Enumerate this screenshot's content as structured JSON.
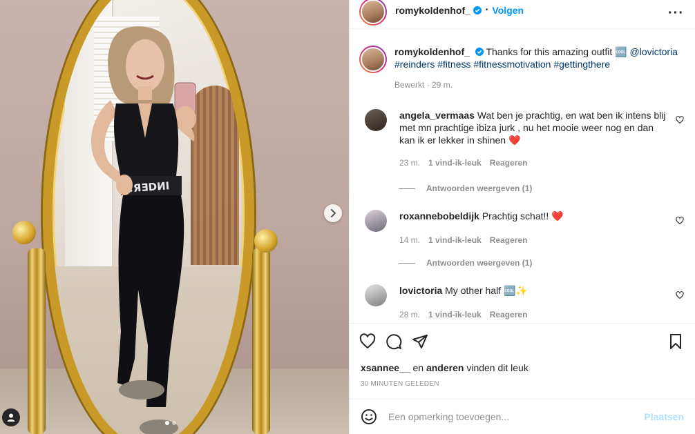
{
  "post": {
    "author": "romykoldenhof_",
    "follow_label": "Volgen",
    "more_icon": "more-horizontal-icon",
    "caption_prefix": "Thanks for this amazing outfit 🆒",
    "caption_mention": "@lovictoria",
    "caption_tags": "#reinders #fitness #fitnessmotivation #gettingthere",
    "caption_meta": "Bewerkt · 29 m.",
    "carousel_next_icon": "chevron-right-icon",
    "tagged_user_icon": "user-icon"
  },
  "comments": [
    {
      "user": "angela_vermaas",
      "text": "Wat ben je prachtig, en wat ben ik intens blij met mn prachtige ibiza jurk , nu het mooie weer nog en dan kan ik er lekker in shinen ❤️",
      "time": "23 m.",
      "likes": "1 vind-ik-leuk",
      "reply": "Reageren",
      "replies": "Antwoorden weergeven (1)"
    },
    {
      "user": "roxannebobeldijk",
      "text": "Prachtig schat!! ❤️",
      "time": "14 m.",
      "likes": "1 vind-ik-leuk",
      "reply": "Reageren",
      "replies": "Antwoorden weergeven (1)"
    },
    {
      "user": "lovictoria",
      "text": "My other half 🆒✨",
      "time": "28 m.",
      "likes": "1 vind-ik-leuk",
      "reply": "Reageren"
    }
  ],
  "likes_line": {
    "user": "xsannee__",
    "mid": " en ",
    "others": "anderen",
    "suffix": " vinden dit leuk"
  },
  "timestamp": "30 MINUTEN GELEDEN",
  "add_comment": {
    "placeholder": "Een opmerking toevoegen...",
    "post_label": "Plaatsen"
  },
  "colors": {
    "accent": "#0095f6",
    "link": "#00376b",
    "muted": "#8e8e8e",
    "post_disabled": "#b2dffc"
  }
}
